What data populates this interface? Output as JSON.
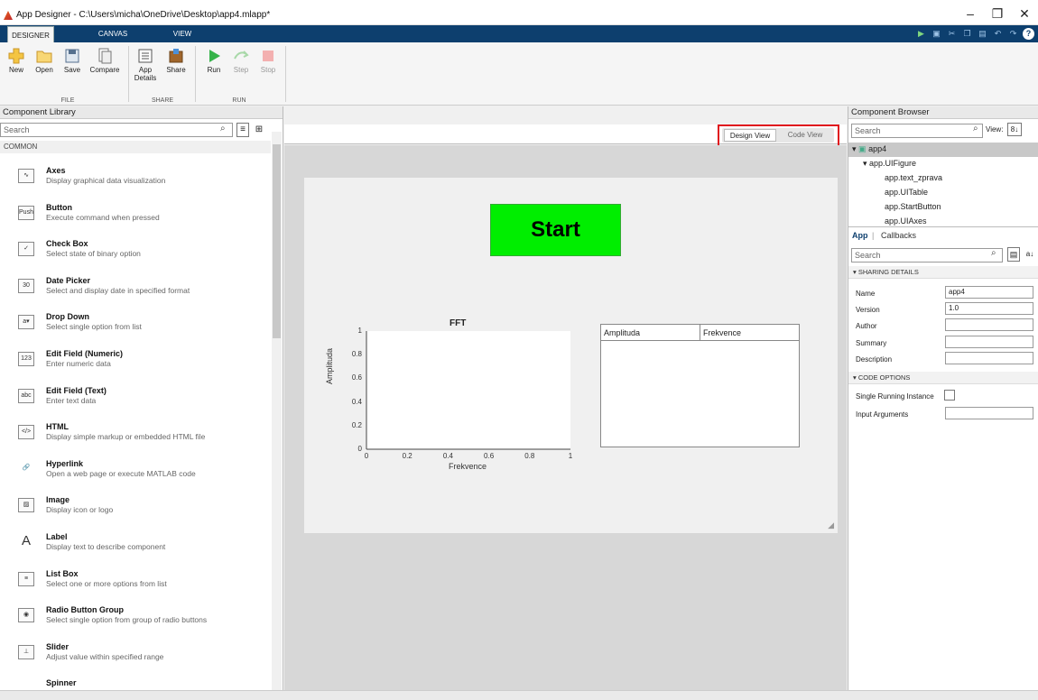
{
  "window": {
    "title": "App Designer - C:\\Users\\micha\\OneDrive\\Desktop\\app4.mlapp*",
    "minimize": "–",
    "restore": "❐",
    "close": "✕"
  },
  "ribbon_tabs": [
    "DESIGNER",
    "CANVAS",
    "VIEW"
  ],
  "ribbon": {
    "buttons": {
      "new": "New",
      "open": "Open",
      "save": "Save",
      "compare": "Compare",
      "app_details": "App Details",
      "share": "Share",
      "run": "Run",
      "step": "Step",
      "stop": "Stop"
    },
    "sections": {
      "file": "FILE",
      "share": "SHARE",
      "run": "RUN"
    }
  },
  "component_library": {
    "title": "Component Library",
    "search_placeholder": "Search",
    "category": "COMMON",
    "items": [
      {
        "name": "Axes",
        "desc": "Display graphical data visualization",
        "icon": "axes-icon",
        "glyph": "∿"
      },
      {
        "name": "Button",
        "desc": "Execute command when pressed",
        "icon": "button-icon",
        "glyph": "Push"
      },
      {
        "name": "Check Box",
        "desc": "Select state of binary option",
        "icon": "checkbox-icon",
        "glyph": "✓"
      },
      {
        "name": "Date Picker",
        "desc": "Select and display date in specified format",
        "icon": "date-picker-icon",
        "glyph": "30"
      },
      {
        "name": "Drop Down",
        "desc": "Select single option from list",
        "icon": "dropdown-icon",
        "glyph": "a▾"
      },
      {
        "name": "Edit Field (Numeric)",
        "desc": "Enter numeric data",
        "icon": "numeric-field-icon",
        "glyph": "123"
      },
      {
        "name": "Edit Field (Text)",
        "desc": "Enter text data",
        "icon": "text-field-icon",
        "glyph": "abc"
      },
      {
        "name": "HTML",
        "desc": "Display simple markup or embedded HTML file",
        "icon": "html-icon",
        "glyph": "</>"
      },
      {
        "name": "Hyperlink",
        "desc": "Open a web page or execute MATLAB code",
        "icon": "hyperlink-icon",
        "glyph": "🔗"
      },
      {
        "name": "Image",
        "desc": "Display icon or logo",
        "icon": "image-icon",
        "glyph": "▨"
      },
      {
        "name": "Label",
        "desc": "Display text to describe component",
        "icon": "label-icon",
        "glyph": "A"
      },
      {
        "name": "List Box",
        "desc": "Select one or more options from list",
        "icon": "listbox-icon",
        "glyph": "≡"
      },
      {
        "name": "Radio Button Group",
        "desc": "Select single option from group of radio buttons",
        "icon": "radio-group-icon",
        "glyph": "◉"
      },
      {
        "name": "Slider",
        "desc": "Adjust value within specified range",
        "icon": "slider-icon",
        "glyph": "⊥"
      },
      {
        "name": "Spinner",
        "desc": "",
        "icon": "spinner-icon",
        "glyph": ""
      }
    ]
  },
  "canvas": {
    "design_view": "Design View",
    "code_view": "Code View",
    "start_button": "Start",
    "axes": {
      "title": "FFT",
      "xlabel": "Frekvence",
      "ylabel": "Amplituda",
      "xticks": [
        "0",
        "0.2",
        "0.4",
        "0.6",
        "0.8",
        "1"
      ],
      "yticks": [
        "0",
        "0.2",
        "0.4",
        "0.6",
        "0.8",
        "1"
      ]
    },
    "table_columns": [
      "Amplituda",
      "Frekvence"
    ]
  },
  "component_browser": {
    "title": "Component Browser",
    "search_placeholder": "Search",
    "view_label": "View:",
    "tree": [
      "app4",
      "app.UIFigure",
      "app.text_zprava",
      "app.UITable",
      "app.StartButton",
      "app.UIAxes"
    ],
    "tabs": [
      "App",
      "Callbacks"
    ],
    "props_search_placeholder": "Search",
    "sharing_details": "SHARING DETAILS",
    "props": [
      {
        "label": "Name",
        "value": "app4"
      },
      {
        "label": "Version",
        "value": "1.0"
      },
      {
        "label": "Author",
        "value": ""
      },
      {
        "label": "Summary",
        "value": ""
      },
      {
        "label": "Description",
        "value": ""
      }
    ],
    "code_options": "CODE OPTIONS",
    "single_running_instance": "Single Running Instance",
    "input_arguments": "Input Arguments"
  }
}
